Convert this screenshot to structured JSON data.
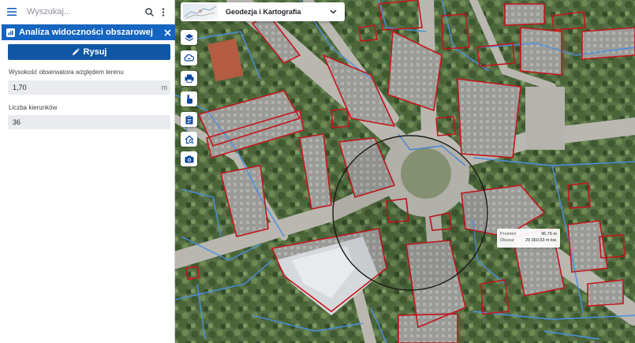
{
  "search": {
    "placeholder": "Wyszukaj..."
  },
  "tool": {
    "title": "Analiza widoczności obszarowej",
    "draw_label": "Rysuj",
    "observer_height_label": "Wysokość obserwatora względem terenu",
    "observer_height_value": "1,70",
    "observer_height_unit": "m",
    "directions_label": "Liczba kierunków",
    "directions_value": "36"
  },
  "map": {
    "selector_label": "Geodezja i Kartografia",
    "tooltip": {
      "radius_label": "Promień",
      "radius_value": "96,76 m",
      "area_label": "Obszar",
      "area_value": "29 360,93 m kw."
    }
  },
  "icons": {
    "menu": "hamburger-icon",
    "search": "search-icon",
    "more": "more-vertical-icon",
    "close": "close-icon",
    "draw": "pencil-icon",
    "chevron": "chevron-down-icon",
    "layers": "layers-icon",
    "cloud": "cloud-icon",
    "print": "print-icon",
    "touch": "touch-icon",
    "clipboard": "clipboard-icon",
    "home-search": "home-search-icon",
    "camera": "camera-icon"
  },
  "colors": {
    "primary": "#1565c0",
    "button": "#0f57a5",
    "building_outline": "#c4161c",
    "parcel_line": "#4a90e2",
    "tool_icon": "#0d47a1"
  }
}
